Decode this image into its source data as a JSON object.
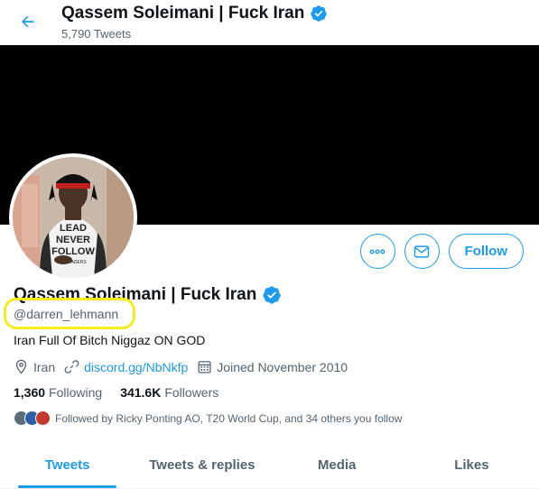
{
  "header": {
    "title": "Qassem Soleimani | Fuck Iran",
    "tweet_count": "5,790 Tweets"
  },
  "profile": {
    "display_name": "Qassem Soleimani | Fuck Iran",
    "handle": "@darren_lehmann",
    "bio": "Iran Full Of Bitch Niggaz ON GOD",
    "location": "Iran",
    "website": "discord.gg/NbNkfp",
    "joined": "Joined November 2010",
    "following_count": "1,360",
    "following_label": "Following",
    "followers_count": "341.6K",
    "followers_label": "Followers",
    "followed_by": "Followed by Ricky Ponting AO, T20 World Cup, and 34 others you follow",
    "avatar_shirt_text": [
      "LEAD",
      "NEVER",
      "FOLLOW",
      "LEADERS"
    ]
  },
  "actions": {
    "follow_label": "Follow"
  },
  "tabs": [
    {
      "label": "Tweets",
      "active": true
    },
    {
      "label": "Tweets & replies",
      "active": false
    },
    {
      "label": "Media",
      "active": false
    },
    {
      "label": "Likes",
      "active": false
    }
  ],
  "colors": {
    "accent": "#1d9bf0",
    "banner": "#000000",
    "highlight": "#f4ec1e"
  }
}
